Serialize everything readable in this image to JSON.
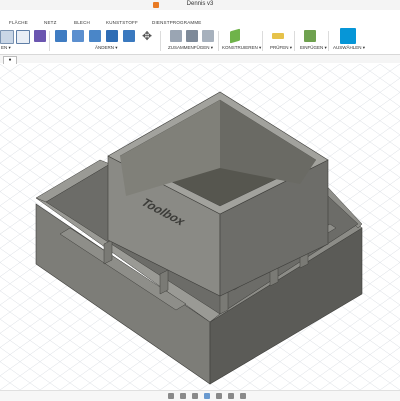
{
  "app": {
    "title": "Dennis v3"
  },
  "ribbon": {
    "tabs": [
      "FLÄCHE",
      "NETZ",
      "BLECH",
      "KUNSTSTOFF",
      "DIENSTPROGRAMME"
    ],
    "groups": [
      "EN ▾",
      "ÄNDERN ▾",
      "ZUSAMMENFÜGEN ▾",
      "KONSTRUIEREN ▾",
      "PRÜFEN ▾",
      "EINFÜGEN ▾",
      "AUSWÄHLEN ▾"
    ]
  },
  "model": {
    "emboss_text": "Toolbox"
  },
  "nav": {
    "browser_toggle": "●"
  },
  "colors": {
    "accent": "#0696d7",
    "body_light": "#8d8d88",
    "body_mid": "#6f6f6b",
    "body_dark": "#4d4d4a",
    "grid": "#d9dde3"
  }
}
